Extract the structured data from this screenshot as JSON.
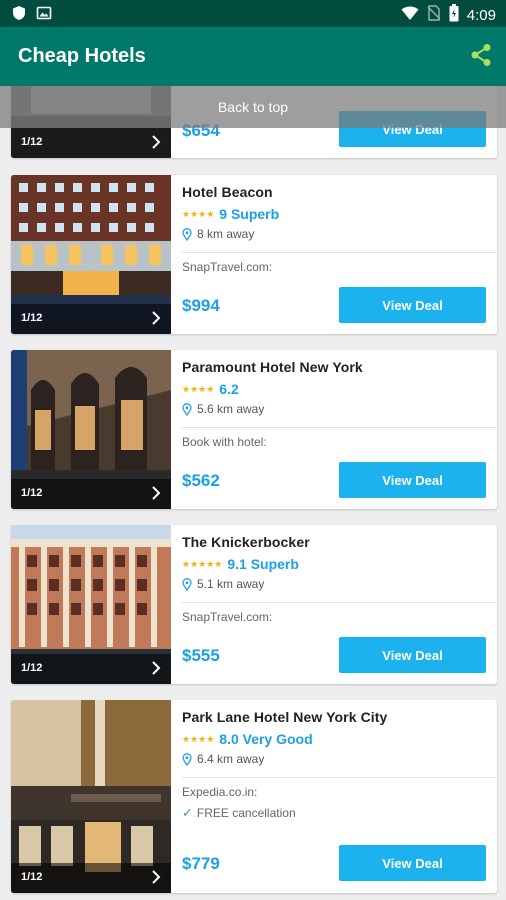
{
  "status_bar": {
    "time": "4:09",
    "icons": [
      "shield-icon",
      "image-icon",
      "wifi-icon",
      "no-sim-icon",
      "battery-icon"
    ]
  },
  "app_bar": {
    "title": "Cheap Hotels",
    "share_icon": "share-icon",
    "accent": "#a7e35a"
  },
  "back_to_top": "Back to top",
  "hotels": [
    {
      "name": "",
      "photo_count": "1/12",
      "price": "$654",
      "deal_label": "View Deal"
    },
    {
      "name": "Hotel Beacon",
      "stars": "★★★★",
      "score": "9 Superb",
      "distance": "8 km away",
      "provider": "SnapTravel.com:",
      "price": "$994",
      "deal_label": "View Deal",
      "photo_count": "1/12"
    },
    {
      "name": "Paramount Hotel New York",
      "stars": "★★★★",
      "score": "6.2",
      "distance": "5.6 km away",
      "provider": "Book with hotel:",
      "price": "$562",
      "deal_label": "View Deal",
      "photo_count": "1/12"
    },
    {
      "name": "The Knickerbocker",
      "stars": "★★★★★",
      "score": "9.1 Superb",
      "distance": "5.1 km away",
      "provider": "SnapTravel.com:",
      "price": "$555",
      "deal_label": "View Deal",
      "photo_count": "1/12"
    },
    {
      "name": "Park Lane Hotel New York City",
      "stars": "★★★★",
      "score": "8.0 Very Good",
      "distance": "6.4 km away",
      "provider": "Expedia.co.in:",
      "perk": "FREE cancellation",
      "price": "$779",
      "deal_label": "View Deal",
      "photo_count": "1/12"
    }
  ],
  "colors": {
    "status_bar": "#004d40",
    "app_bar": "#00796b",
    "price": "#1ca0e6",
    "button": "#1bb2ee",
    "stars": "#f5b400"
  }
}
